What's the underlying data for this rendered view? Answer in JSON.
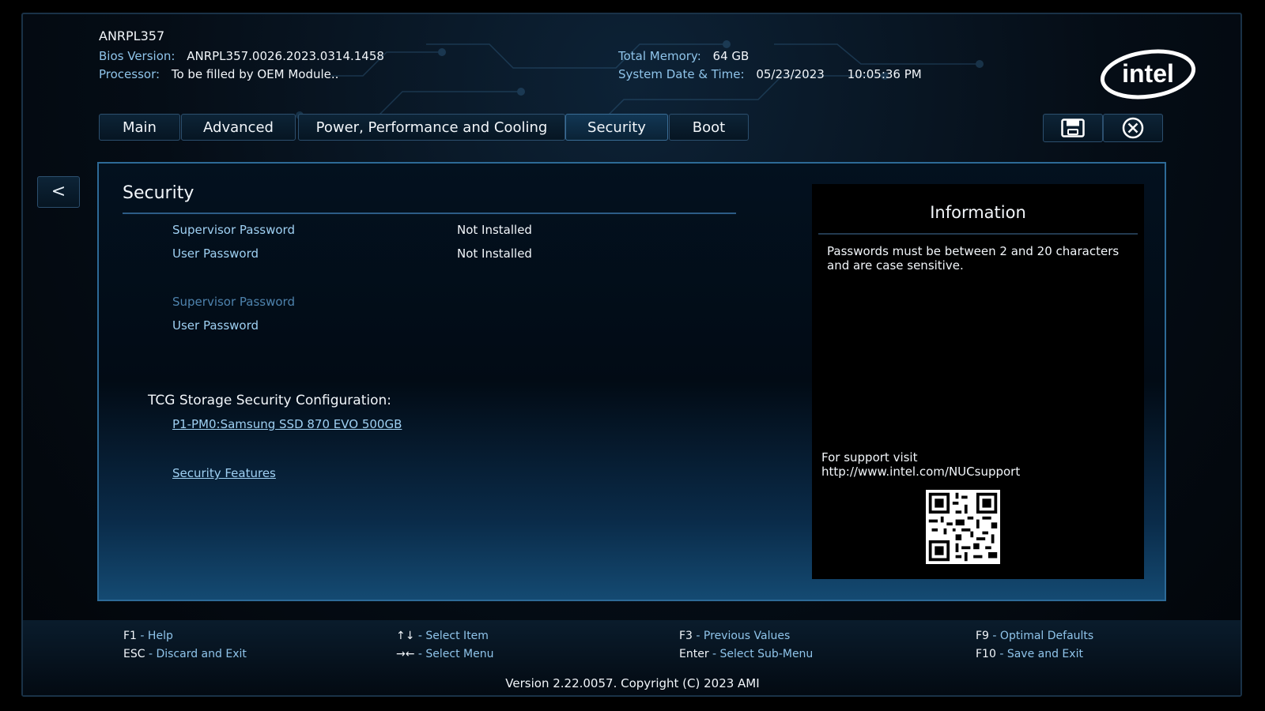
{
  "header": {
    "model": "ANRPL357",
    "bios_label": "Bios Version:",
    "bios_value": "ANRPL357.0026.2023.0314.1458",
    "processor_label": "Processor:",
    "processor_value": "To be filled by OEM Module..",
    "memory_label": "Total Memory:",
    "memory_value": "64 GB",
    "datetime_label": "System Date & Time:",
    "date_value": "05/23/2023",
    "time_value": "10:05:36 PM"
  },
  "tabs": [
    {
      "label": "Main",
      "active": false
    },
    {
      "label": "Advanced",
      "active": false
    },
    {
      "label": "Power, Performance and Cooling",
      "active": false
    },
    {
      "label": "Security",
      "active": true
    },
    {
      "label": "Boot",
      "active": false
    }
  ],
  "toolbar": {
    "save_icon": "save-icon",
    "exit_icon": "close-circle-icon",
    "back_label": "<"
  },
  "security": {
    "title": "Security",
    "status_rows": [
      {
        "label": "Supervisor Password",
        "value": "Not Installed"
      },
      {
        "label": "User Password",
        "value": "Not Installed"
      }
    ],
    "password_items": [
      {
        "label": "Supervisor Password",
        "enabled": false
      },
      {
        "label": "User Password",
        "enabled": true
      }
    ],
    "tcg_heading": "TCG Storage Security Configuration:",
    "tcg_device": "P1-PM0:Samsung SSD 870 EVO 500GB",
    "security_features": "Security Features"
  },
  "info": {
    "title": "Information",
    "text": "Passwords must be between 2 and 20 characters and are case sensitive.",
    "support_line1": "For support visit",
    "support_line2": "http://www.intel.com/NUCsupport"
  },
  "footer": {
    "keys": [
      {
        "key": "F1",
        "desc": "Help"
      },
      {
        "key": "ESC",
        "desc": "Discard and Exit"
      },
      {
        "key": "↑↓",
        "desc": "Select Item"
      },
      {
        "key": "→←",
        "desc": "Select Menu"
      },
      {
        "key": "F3",
        "desc": "Previous Values"
      },
      {
        "key": "Enter",
        "desc": "Select Sub-Menu"
      },
      {
        "key": "F9",
        "desc": "Optimal Defaults"
      },
      {
        "key": "F10",
        "desc": "Save and Exit"
      }
    ],
    "version": "Version 2.22.0057. Copyright (C) 2023 AMI"
  },
  "brand": {
    "logo_text": "intel",
    "accent": "#2d6a97",
    "link_color": "#9fd0f2"
  }
}
